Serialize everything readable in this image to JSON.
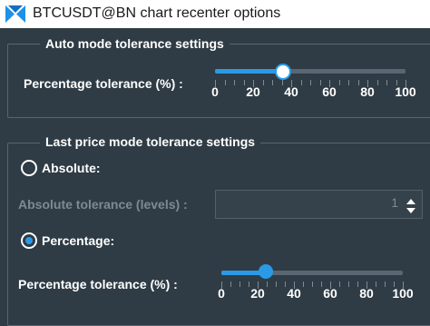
{
  "window": {
    "title": "BTCUSDT@BN chart recenter options",
    "icon": "tradingview-x-logo-icon"
  },
  "auto_mode": {
    "group_title": "Auto mode tolerance settings",
    "tolerance_label": "Percentage tolerance (%) :",
    "slider_value": 35,
    "scale_labels": [
      "0",
      "20",
      "40",
      "60",
      "80",
      "100"
    ]
  },
  "last_price_mode": {
    "group_title": "Last price mode tolerance settings",
    "absolute_label": "Absolute:",
    "absolute_selected": false,
    "absolute_tolerance_label": "Absolute tolerance (levels) :",
    "absolute_tolerance_value": "1",
    "percentage_label": "Percentage:",
    "percentage_selected": true,
    "tolerance_label": "Percentage tolerance (%) :",
    "slider_value": 25,
    "scale_labels": [
      "0",
      "20",
      "40",
      "60",
      "80",
      "100"
    ]
  },
  "colors": {
    "accent": "#2b9ae6",
    "background": "#2f3c45",
    "border": "#586671"
  }
}
